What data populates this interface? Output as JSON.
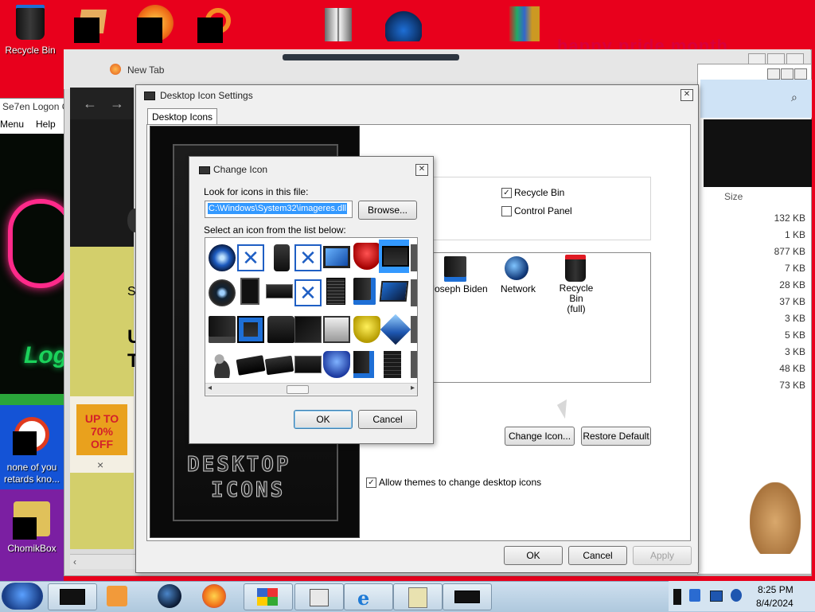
{
  "desktop": {
    "icons": [
      {
        "label": "Recycle Bin"
      },
      {
        "label": "none of you retards kno..."
      },
      {
        "label": "ChomikBox"
      }
    ],
    "banner_text": "happy pride month",
    "side_window_title": "Se7en Logon C",
    "side_menu": [
      "Menu",
      "Help"
    ]
  },
  "browser": {
    "tab_label": "New Tab",
    "ad_text": "UP TO 70% OFF",
    "ad_close": "×",
    "web_snippets": [
      "S",
      "U",
      "T"
    ]
  },
  "explorer": {
    "column_header": "Size",
    "sizes": [
      "132 KB",
      "1 KB",
      "877 KB",
      "7 KB",
      "28 KB",
      "37 KB",
      "3 KB",
      "5 KB",
      "3 KB",
      "48 KB",
      "73 KB"
    ]
  },
  "desktop_icon_settings": {
    "title": "Desktop Icons Settings",
    "title_display": "Desktop Icon Settings",
    "tab": "Desktop Icons",
    "preview_text_line1": "DESKTOP",
    "preview_text_line2": "ICONS",
    "checkboxes": [
      {
        "label": "Recycle Bin",
        "checked": true
      },
      {
        "label": "Control Panel",
        "checked": false
      }
    ],
    "icons": [
      {
        "label": "Joseph Biden"
      },
      {
        "label": "Network"
      },
      {
        "label": "Recycle Bin\n(full)"
      }
    ],
    "change_icon_button": "Change Icon...",
    "restore_default_button": "Restore Default",
    "allow_themes_label": "Allow themes to change desktop icons",
    "allow_themes_checked": true,
    "ok": "OK",
    "cancel": "Cancel",
    "apply": "Apply"
  },
  "change_icon": {
    "title": "Change Icon",
    "look_for_label": "Look for icons in this file:",
    "file_path": "C:\\Windows\\System32\\imageres.dll",
    "browse": "Browse...",
    "select_label": "Select an icon from the list below:",
    "ok": "OK",
    "cancel": "Cancel"
  },
  "taskbar": {
    "time": "8:25 PM",
    "date": "8/4/2024"
  }
}
